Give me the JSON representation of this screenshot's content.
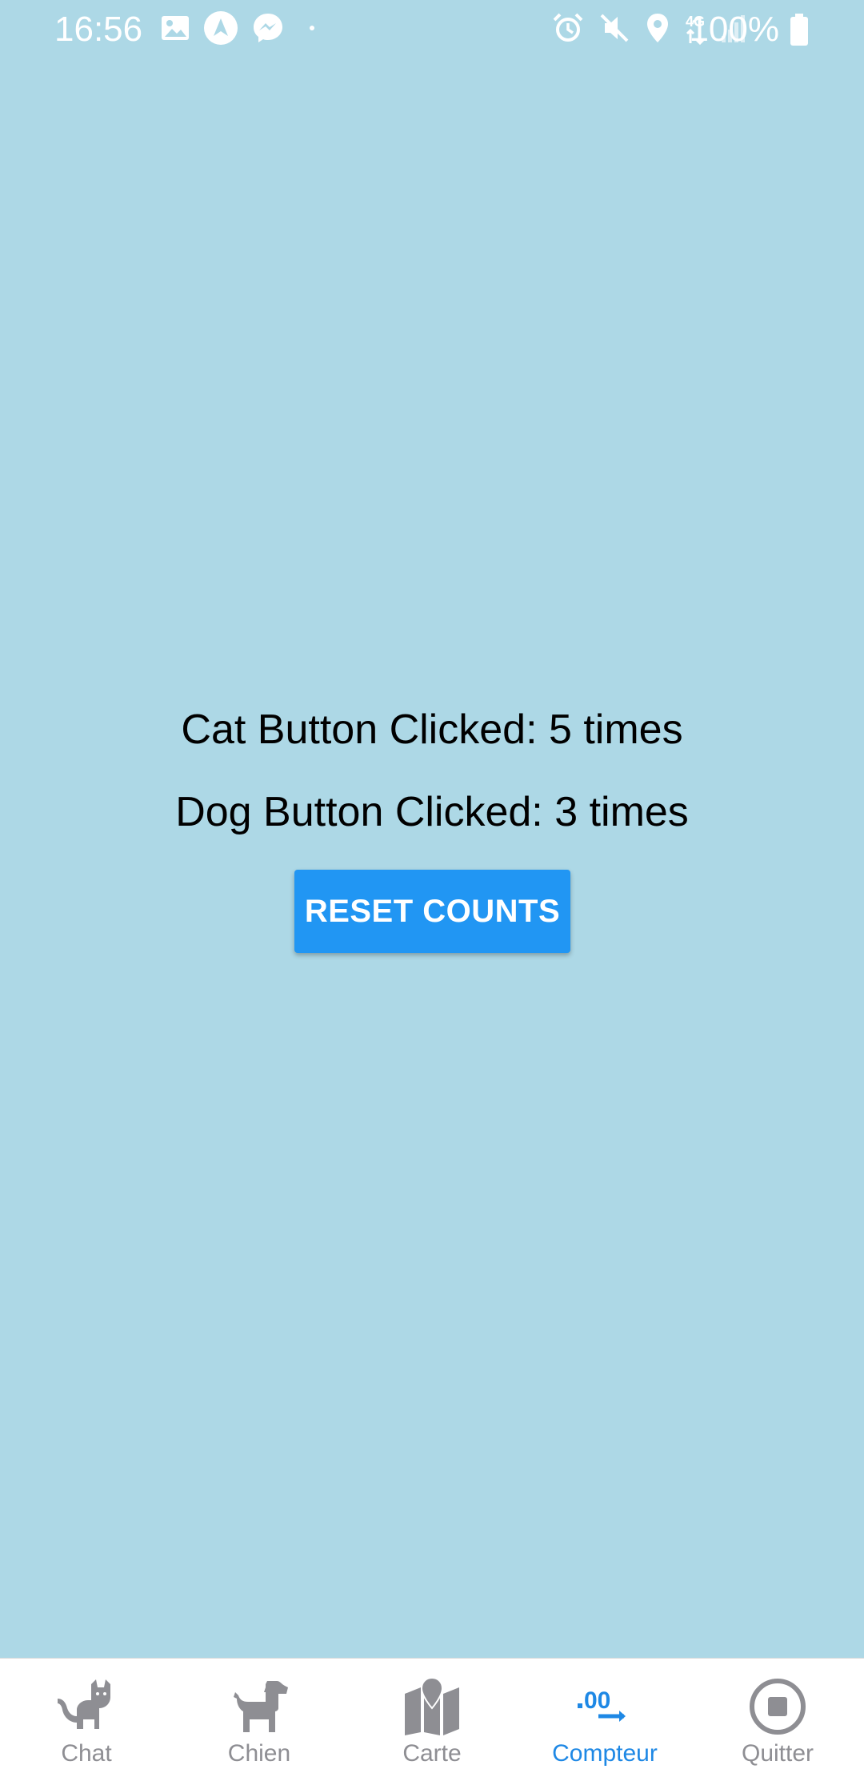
{
  "status_bar": {
    "time": "16:56",
    "battery": "100%",
    "left_icons": [
      "image-icon",
      "navigation-icon",
      "messenger-icon",
      "dot-icon"
    ],
    "right_icons": [
      "alarm-icon",
      "mute-icon",
      "location-icon",
      "network-4g-icon",
      "signal-icon"
    ],
    "network_label": "4G"
  },
  "main": {
    "cat_count_text": "Cat Button Clicked: 5 times",
    "dog_count_text": "Dog Button Clicked: 3 times",
    "reset_label": "RESET COUNTS"
  },
  "tabs": [
    {
      "label": "Chat",
      "icon": "cat-icon",
      "active": false
    },
    {
      "label": "Chien",
      "icon": "dog-icon",
      "active": false
    },
    {
      "label": "Carte",
      "icon": "map-icon",
      "active": false
    },
    {
      "label": "Compteur",
      "icon": "decimal-increase-icon",
      "active": true
    },
    {
      "label": "Quitter",
      "icon": "stop-circle-icon",
      "active": false
    }
  ],
  "colors": {
    "background": "#add8e6",
    "accent": "#2196f3",
    "active_tab": "#1e88e5",
    "inactive_tab": "#8e8e93"
  }
}
